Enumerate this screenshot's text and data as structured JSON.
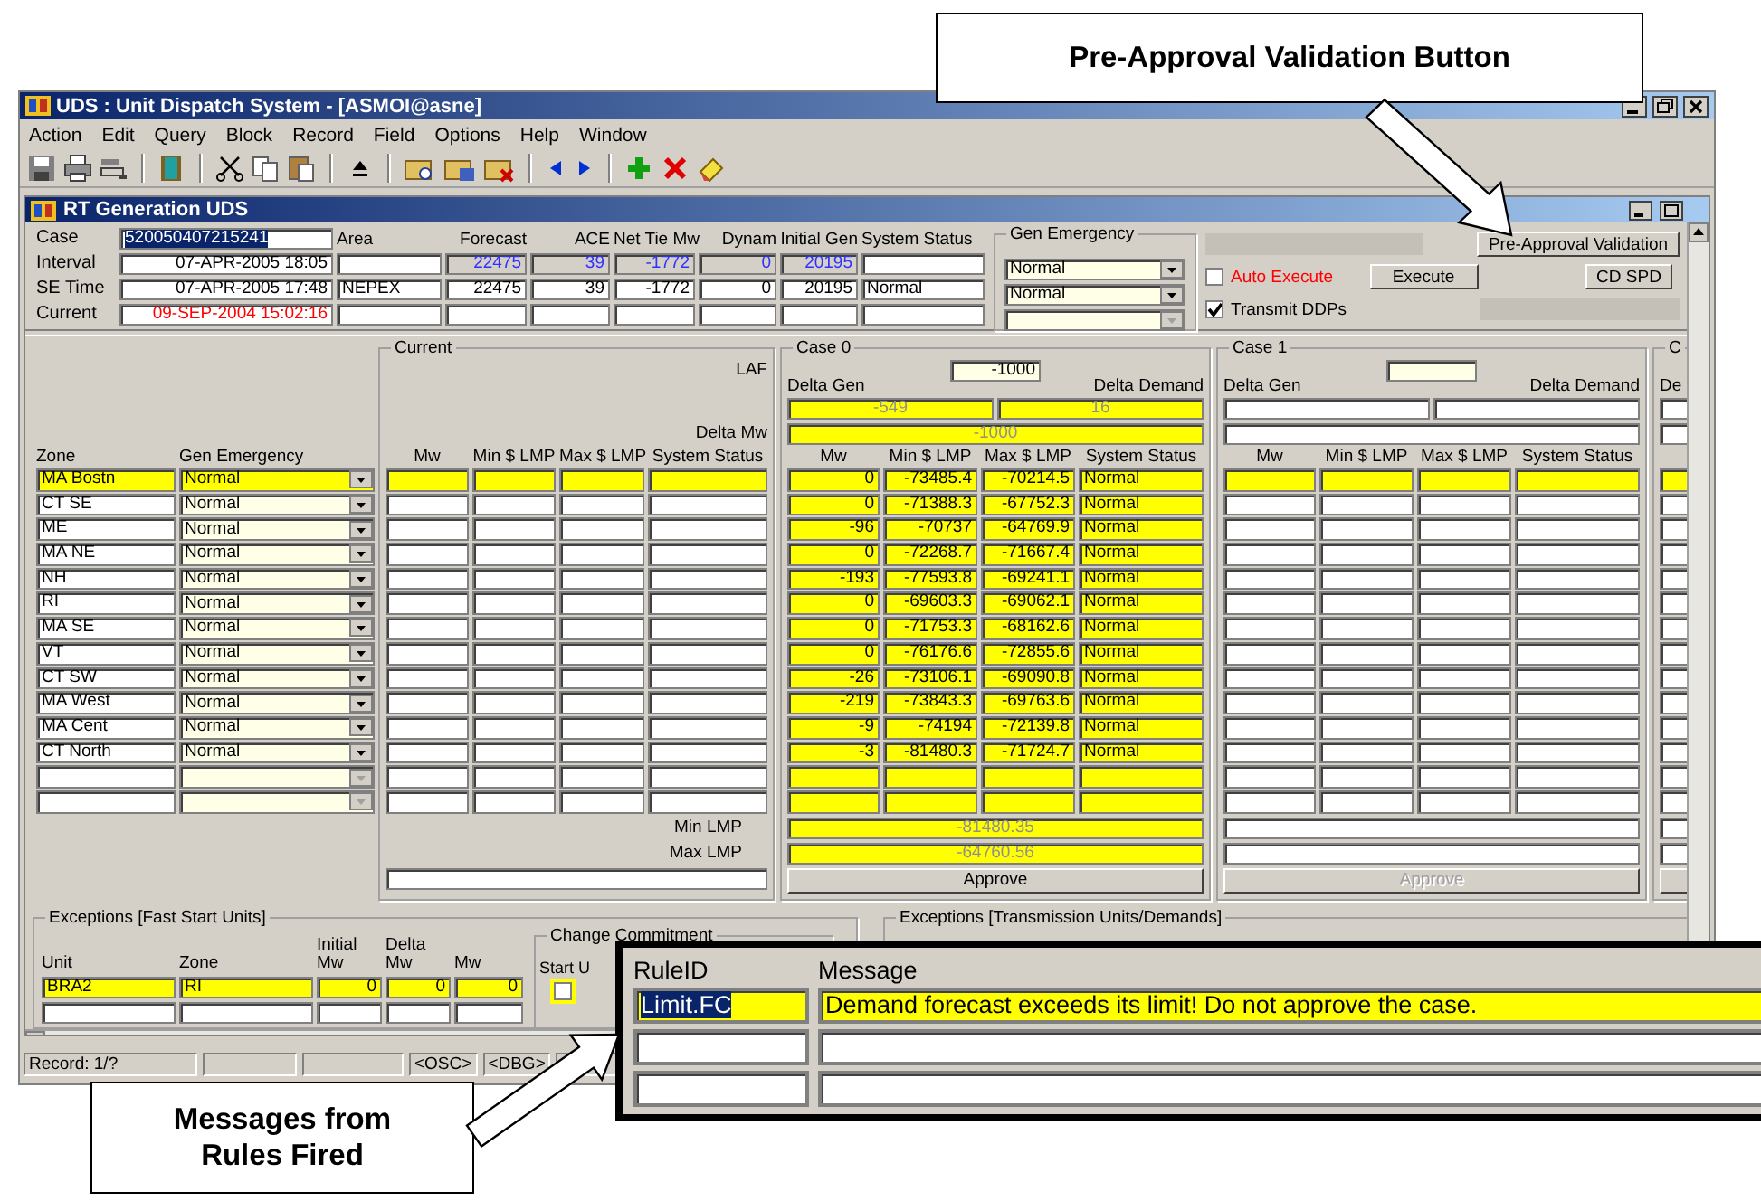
{
  "window": {
    "title": "UDS : Unit Dispatch System - [ASMOI@asne]"
  },
  "menu": [
    "Action",
    "Edit",
    "Query",
    "Block",
    "Record",
    "Field",
    "Options",
    "Help",
    "Window"
  ],
  "form": {
    "title": "RT Generation UDS",
    "case": {
      "label": "Case",
      "value": "520050407215241",
      "selected": true
    },
    "columns": [
      "Area",
      "Forecast",
      "ACE",
      "Net Tie Mw",
      "Dynam",
      "Initial Gen",
      "System Status"
    ],
    "rows": [
      {
        "label": "Interval",
        "kind": "readonly",
        "time": "07-APR-2005 18:05",
        "forecast": "22475",
        "ace": "39",
        "net_tie_mw": "-1772",
        "dynam": "0",
        "initial_gen": "20195"
      },
      {
        "label": "SE Time",
        "kind": "plain",
        "time": "07-APR-2005 17:48",
        "area": "NEPEX",
        "forecast": "22475",
        "ace": "39",
        "net_tie_mw": "-1772",
        "dynam": "0",
        "initial_gen": "20195",
        "system_status": "Normal"
      },
      {
        "label": "Current",
        "kind": "clock",
        "time": "09-SEP-2004 15:02:16"
      }
    ],
    "gen_emergency": {
      "title": "Gen Emergency",
      "options": [
        {
          "value": "Normal",
          "disabled": false
        },
        {
          "value": "Normal",
          "disabled": false
        },
        {
          "disabled": true
        }
      ]
    },
    "pre_approval_button": "Pre-Approval Validation",
    "auto_execute": {
      "label": "Auto Execute",
      "checked": false
    },
    "execute_button": "Execute",
    "cd_spd_button": "CD SPD",
    "transmit_ddps": {
      "label": "Transmit DDPs",
      "checked": true
    }
  },
  "zones": {
    "columns": [
      "Zone",
      "Gen Emergency"
    ],
    "rows": [
      {
        "zone": "MA Bostn",
        "gen_emergency": "Normal",
        "selected": true,
        "disabled": false
      },
      {
        "zone": "CT SE",
        "gen_emergency": "Normal",
        "selected": false,
        "disabled": false
      },
      {
        "zone": "ME",
        "gen_emergency": "Normal",
        "selected": false,
        "disabled": false
      },
      {
        "zone": "MA NE",
        "gen_emergency": "Normal",
        "selected": false,
        "disabled": false
      },
      {
        "zone": "NH",
        "gen_emergency": "Normal",
        "selected": false,
        "disabled": false
      },
      {
        "zone": "RI",
        "gen_emergency": "Normal",
        "selected": false,
        "disabled": false
      },
      {
        "zone": "MA SE",
        "gen_emergency": "Normal",
        "selected": false,
        "disabled": false
      },
      {
        "zone": "VT",
        "gen_emergency": "Normal",
        "selected": false,
        "disabled": false
      },
      {
        "zone": "CT SW",
        "gen_emergency": "Normal",
        "selected": false,
        "disabled": false
      },
      {
        "zone": "MA West",
        "gen_emergency": "Normal",
        "selected": false,
        "disabled": false
      },
      {
        "zone": "MA Cent",
        "gen_emergency": "Normal",
        "selected": false,
        "disabled": false
      },
      {
        "zone": "CT North",
        "gen_emergency": "Normal",
        "selected": false,
        "disabled": false
      },
      {
        "selected": false,
        "disabled": true
      },
      {
        "selected": false,
        "disabled": true
      }
    ]
  },
  "current": {
    "title": "Current",
    "laf_label": "LAF",
    "delta_mw_label": "Delta  Mw",
    "columns": [
      "Mw",
      "Min $ LMP",
      "Max $ LMP",
      "System Status"
    ],
    "min_lmp_label": "Min LMP",
    "max_lmp_label": "Max LMP"
  },
  "cases": [
    {
      "title": "Case 0",
      "laf": "-1000",
      "delta_gen_label": "Delta Gen",
      "delta_demand_label": "Delta Demand",
      "delta_gen": "-549",
      "delta_demand": "16",
      "delta_mw": "-1000",
      "columns": [
        "Mw",
        "Min $ LMP",
        "Max $ LMP",
        "System Status"
      ],
      "filled": true,
      "rows": [
        {
          "mw": "0",
          "min_lmp": "-73485.4",
          "max_lmp": "-70214.5",
          "status": "Normal"
        },
        {
          "mw": "0",
          "min_lmp": "-71388.3",
          "max_lmp": "-67752.3",
          "status": "Normal"
        },
        {
          "mw": "-96",
          "min_lmp": "-70737",
          "max_lmp": "-64769.9",
          "status": "Normal"
        },
        {
          "mw": "0",
          "min_lmp": "-72268.7",
          "max_lmp": "-71667.4",
          "status": "Normal"
        },
        {
          "mw": "-193",
          "min_lmp": "-77593.8",
          "max_lmp": "-69241.1",
          "status": "Normal"
        },
        {
          "mw": "0",
          "min_lmp": "-69603.3",
          "max_lmp": "-69062.1",
          "status": "Normal"
        },
        {
          "mw": "0",
          "min_lmp": "-71753.3",
          "max_lmp": "-68162.6",
          "status": "Normal"
        },
        {
          "mw": "0",
          "min_lmp": "-76176.6",
          "max_lmp": "-72855.6",
          "status": "Normal"
        },
        {
          "mw": "-26",
          "min_lmp": "-73106.1",
          "max_lmp": "-69090.8",
          "status": "Normal"
        },
        {
          "mw": "-219",
          "min_lmp": "-73843.3",
          "max_lmp": "-69763.6",
          "status": "Normal"
        },
        {
          "mw": "-9",
          "min_lmp": "-74194",
          "max_lmp": "-72139.8",
          "status": "Normal"
        },
        {
          "mw": "-3",
          "min_lmp": "-81480.3",
          "max_lmp": "-71724.7",
          "status": "Normal"
        }
      ],
      "min_lmp": "-81480.35",
      "max_lmp": "-64760.56",
      "approve": {
        "label": "Approve",
        "disabled": false
      }
    },
    {
      "title": "Case 1",
      "delta_gen_label": "Delta Gen",
      "delta_demand_label": "Delta Demand",
      "columns": [
        "Mw",
        "Min $ LMP",
        "Max $ LMP",
        "System Status"
      ],
      "filled": false,
      "approve": {
        "label": "Approve",
        "disabled": true
      }
    },
    {
      "title": "C",
      "delta_gen_label": "De"
    }
  ],
  "fast_start": {
    "title": "Exceptions [Fast Start Units]",
    "columns": [
      "Unit",
      "Zone",
      "Initial Mw",
      "Delta Mw",
      "Mw"
    ],
    "rows": [
      {
        "unit": "BRA2",
        "zone": "RI",
        "initial_mw": "0",
        "delta_mw": "0",
        "mw": "0",
        "selected": true
      },
      {
        "selected": false
      }
    ],
    "change_commitment": {
      "title": "Change Commitment",
      "column": "Start U",
      "rows": [
        {
          "checked": false,
          "selected": true
        }
      ]
    }
  },
  "transmission": {
    "title": "Exceptions [Transmission Units/Demands]"
  },
  "status_bar": [
    "Record: 1/?",
    "<OSC>",
    "<DBG>"
  ],
  "rules_popup": {
    "columns": [
      "RuleID",
      "Message"
    ],
    "rows": [
      {
        "rule_id": "Limit.FC",
        "message": "Demand forecast exceeds its limit! Do not approve the case.",
        "selected": true
      },
      {
        "selected": false
      },
      {
        "selected": false
      }
    ]
  },
  "callouts": [
    "Pre-Approval Validation Button",
    "Messages from Rules Fired"
  ]
}
